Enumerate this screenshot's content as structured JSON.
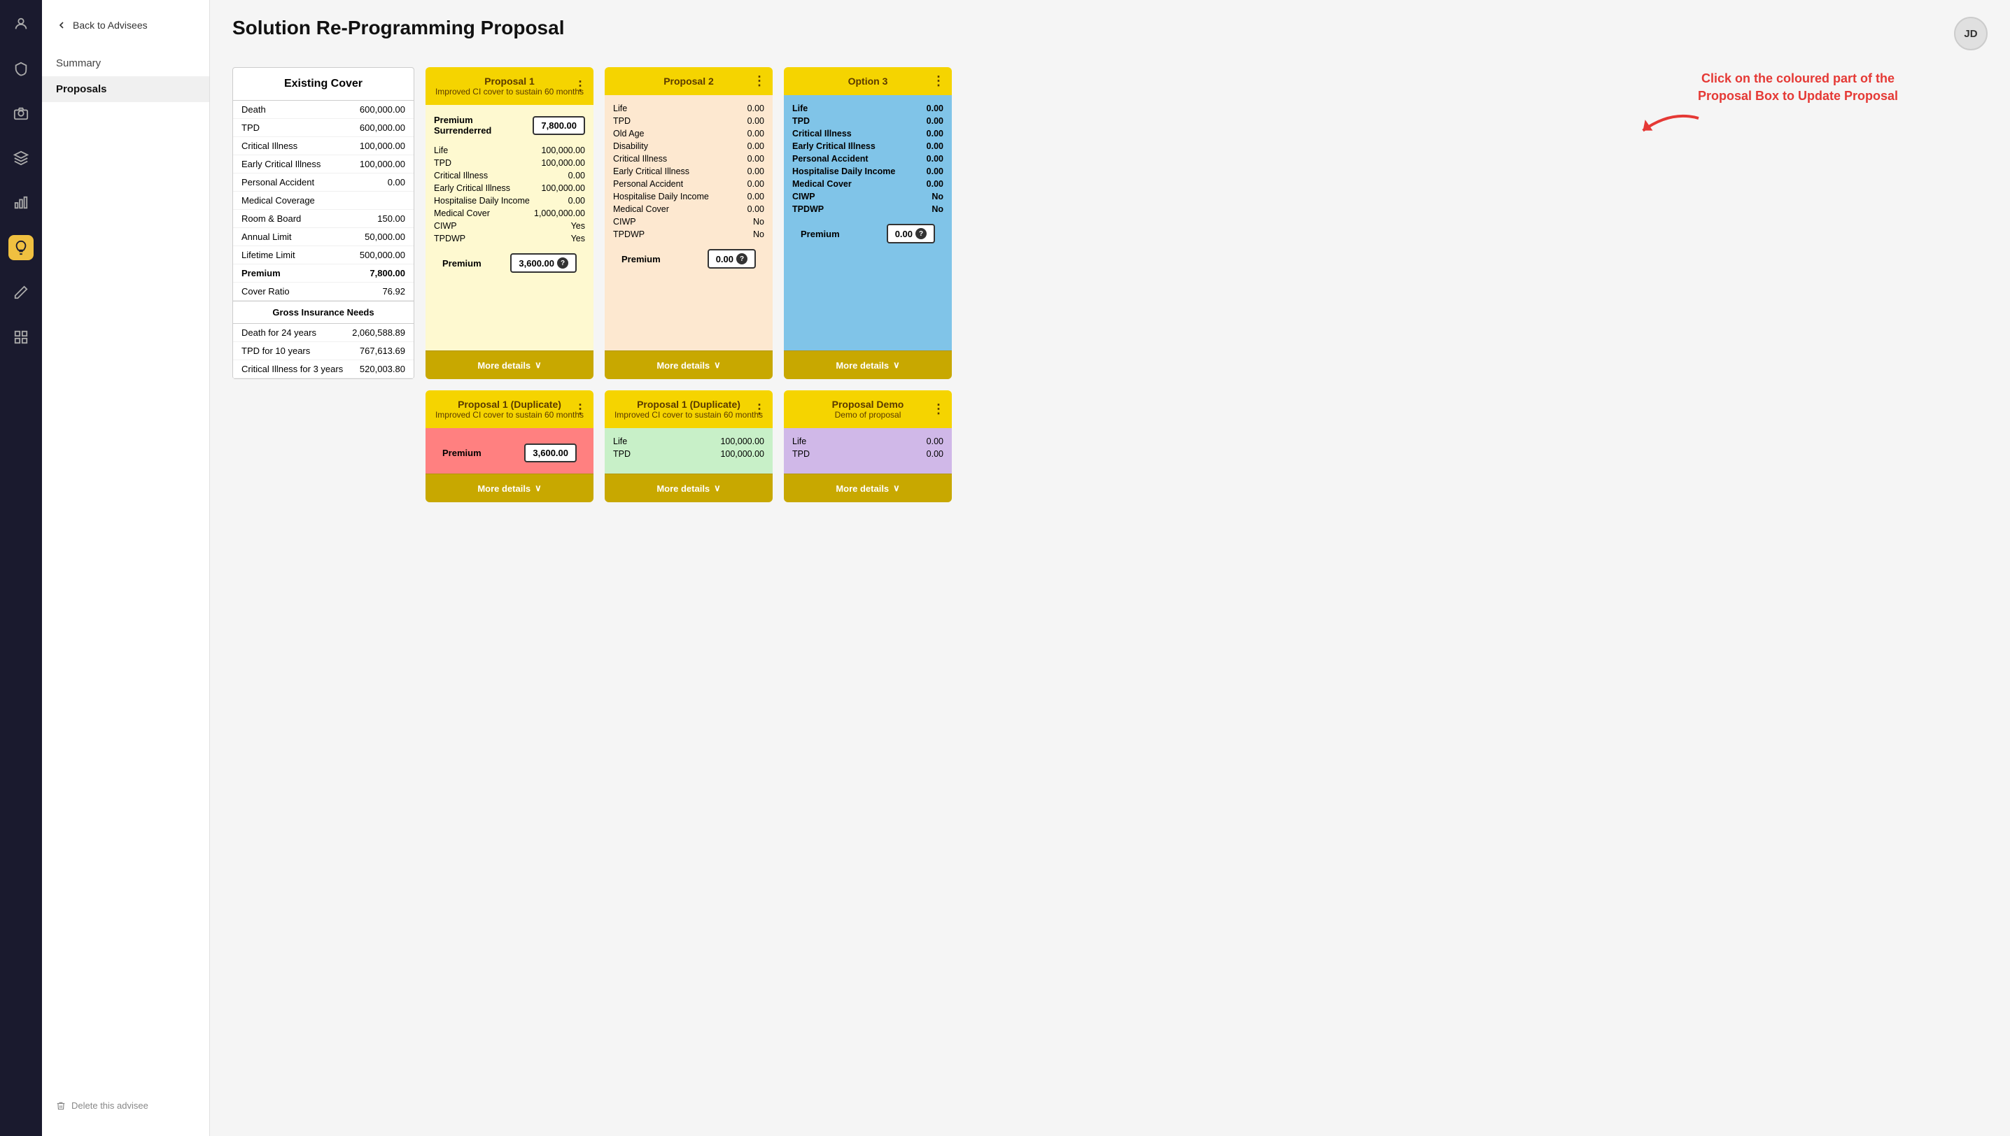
{
  "sidebar": {
    "icons": [
      "person",
      "shield",
      "camera",
      "layers",
      "chart-bar",
      "bulb",
      "pen",
      "grid"
    ]
  },
  "left_panel": {
    "back_label": "Back to Advisees",
    "nav_items": [
      {
        "label": "Summary",
        "active": false
      },
      {
        "label": "Proposals",
        "active": true
      }
    ],
    "delete_label": "Delete this advisee"
  },
  "header": {
    "title": "Solution Re-Programming Proposal",
    "avatar": "JD"
  },
  "hint": {
    "line1": "Click on the coloured part of the",
    "line2": "Proposal Box to Update Proposal"
  },
  "existing_cover": {
    "title": "Existing Cover",
    "rows": [
      {
        "label": "Death",
        "value": "600,000.00"
      },
      {
        "label": "TPD",
        "value": "600,000.00"
      },
      {
        "label": "Critical Illness",
        "value": "100,000.00"
      },
      {
        "label": "Early Critical Illness",
        "value": "100,000.00"
      },
      {
        "label": "Personal Accident",
        "value": "0.00"
      },
      {
        "label": "Medical Coverage",
        "value": ""
      },
      {
        "label": "Room & Board",
        "value": "150.00"
      },
      {
        "label": "Annual Limit",
        "value": "50,000.00"
      },
      {
        "label": "Lifetime Limit",
        "value": "500,000.00"
      },
      {
        "label": "Premium",
        "value": "7,800.00"
      },
      {
        "label": "Cover Ratio",
        "value": "76.92"
      }
    ],
    "gross_section": "Gross Insurance Needs",
    "gross_rows": [
      {
        "label": "Death for 24 years",
        "value": "2,060,588.89"
      },
      {
        "label": "TPD for 10 years",
        "value": "767,613.69"
      },
      {
        "label": "Critical Illness for 3 years",
        "value": "520,003.80"
      }
    ]
  },
  "proposal1": {
    "title": "Proposal 1",
    "subtitle": "Improved CI cover to sustain 60 months",
    "premium_surrendered_label": "Premium Surrenderred",
    "premium_surrendered_value": "7,800.00",
    "rows": [
      {
        "label": "Life",
        "value": "100,000.00"
      },
      {
        "label": "TPD",
        "value": "100,000.00"
      },
      {
        "label": "Critical Illness",
        "value": "0.00"
      },
      {
        "label": "Early Critical Illness",
        "value": "100,000.00"
      },
      {
        "label": "Hospitalise Daily Income",
        "value": "0.00"
      },
      {
        "label": "Medical Cover",
        "value": "1,000,000.00"
      },
      {
        "label": "CIWP",
        "value": "Yes"
      },
      {
        "label": "TPDWP",
        "value": "Yes"
      }
    ],
    "premium_label": "Premium",
    "premium_value": "3,600.00",
    "more_details": "More details"
  },
  "proposal2": {
    "title": "Proposal 2",
    "rows": [
      {
        "label": "Life",
        "value": "0.00"
      },
      {
        "label": "TPD",
        "value": "0.00"
      },
      {
        "label": "Old Age",
        "value": "0.00"
      },
      {
        "label": "Disability",
        "value": "0.00"
      },
      {
        "label": "Critical Illness",
        "value": "0.00"
      },
      {
        "label": "Early Critical Illness",
        "value": "0.00"
      },
      {
        "label": "Personal Accident",
        "value": "0.00"
      },
      {
        "label": "Hospitalise Daily Income",
        "value": "0.00"
      },
      {
        "label": "Medical Cover",
        "value": "0.00"
      },
      {
        "label": "CIWP",
        "value": "No"
      },
      {
        "label": "TPDWP",
        "value": "No"
      }
    ],
    "premium_label": "Premium",
    "premium_value": "0.00",
    "more_details": "More details"
  },
  "option3": {
    "title": "Option 3",
    "rows": [
      {
        "label": "Life",
        "value": "0.00"
      },
      {
        "label": "TPD",
        "value": "0.00"
      },
      {
        "label": "Critical Illness",
        "value": "0.00"
      },
      {
        "label": "Early Critical Illness",
        "value": "0.00"
      },
      {
        "label": "Personal Accident",
        "value": "0.00"
      },
      {
        "label": "Hospitalise Daily Income",
        "value": "0.00"
      },
      {
        "label": "Medical Cover",
        "value": "0.00"
      },
      {
        "label": "CIWP",
        "value": "No"
      },
      {
        "label": "TPDWP",
        "value": "No"
      }
    ],
    "premium_label": "Premium",
    "premium_value": "0.00",
    "more_details": "More details"
  },
  "proposal1_dup": {
    "title": "Proposal 1 (Duplicate)",
    "subtitle": "Improved CI cover to sustain 60 months",
    "premium_label": "Premium",
    "premium_value": "3,600.00",
    "more_details": "More details"
  },
  "proposal1_dup2": {
    "title": "Proposal 1 (Duplicate)",
    "subtitle": "Improved CI cover to sustain 60 months",
    "rows": [
      {
        "label": "Life",
        "value": "100,000.00"
      },
      {
        "label": "TPD",
        "value": "100,000.00"
      }
    ],
    "more_details": "More details"
  },
  "proposal_demo": {
    "title": "Proposal Demo",
    "subtitle": "Demo of proposal",
    "rows": [
      {
        "label": "Life",
        "value": "0.00"
      },
      {
        "label": "TPD",
        "value": "0.00"
      }
    ],
    "more_details": "More details"
  }
}
